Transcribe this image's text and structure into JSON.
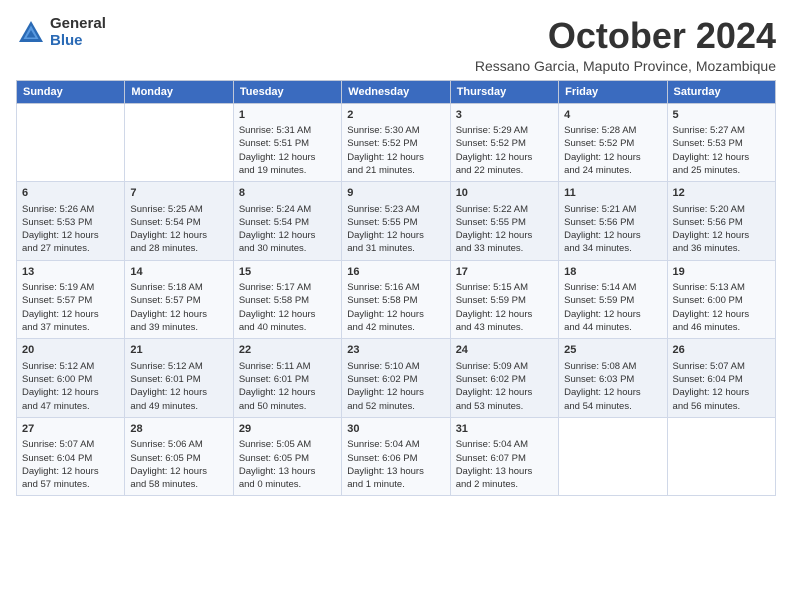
{
  "logo": {
    "general": "General",
    "blue": "Blue"
  },
  "title": "October 2024",
  "subtitle": "Ressano Garcia, Maputo Province, Mozambique",
  "days": [
    "Sunday",
    "Monday",
    "Tuesday",
    "Wednesday",
    "Thursday",
    "Friday",
    "Saturday"
  ],
  "weeks": [
    [
      {
        "day": "",
        "content": ""
      },
      {
        "day": "",
        "content": ""
      },
      {
        "day": "1",
        "content": "Sunrise: 5:31 AM\nSunset: 5:51 PM\nDaylight: 12 hours\nand 19 minutes."
      },
      {
        "day": "2",
        "content": "Sunrise: 5:30 AM\nSunset: 5:52 PM\nDaylight: 12 hours\nand 21 minutes."
      },
      {
        "day": "3",
        "content": "Sunrise: 5:29 AM\nSunset: 5:52 PM\nDaylight: 12 hours\nand 22 minutes."
      },
      {
        "day": "4",
        "content": "Sunrise: 5:28 AM\nSunset: 5:52 PM\nDaylight: 12 hours\nand 24 minutes."
      },
      {
        "day": "5",
        "content": "Sunrise: 5:27 AM\nSunset: 5:53 PM\nDaylight: 12 hours\nand 25 minutes."
      }
    ],
    [
      {
        "day": "6",
        "content": "Sunrise: 5:26 AM\nSunset: 5:53 PM\nDaylight: 12 hours\nand 27 minutes."
      },
      {
        "day": "7",
        "content": "Sunrise: 5:25 AM\nSunset: 5:54 PM\nDaylight: 12 hours\nand 28 minutes."
      },
      {
        "day": "8",
        "content": "Sunrise: 5:24 AM\nSunset: 5:54 PM\nDaylight: 12 hours\nand 30 minutes."
      },
      {
        "day": "9",
        "content": "Sunrise: 5:23 AM\nSunset: 5:55 PM\nDaylight: 12 hours\nand 31 minutes."
      },
      {
        "day": "10",
        "content": "Sunrise: 5:22 AM\nSunset: 5:55 PM\nDaylight: 12 hours\nand 33 minutes."
      },
      {
        "day": "11",
        "content": "Sunrise: 5:21 AM\nSunset: 5:56 PM\nDaylight: 12 hours\nand 34 minutes."
      },
      {
        "day": "12",
        "content": "Sunrise: 5:20 AM\nSunset: 5:56 PM\nDaylight: 12 hours\nand 36 minutes."
      }
    ],
    [
      {
        "day": "13",
        "content": "Sunrise: 5:19 AM\nSunset: 5:57 PM\nDaylight: 12 hours\nand 37 minutes."
      },
      {
        "day": "14",
        "content": "Sunrise: 5:18 AM\nSunset: 5:57 PM\nDaylight: 12 hours\nand 39 minutes."
      },
      {
        "day": "15",
        "content": "Sunrise: 5:17 AM\nSunset: 5:58 PM\nDaylight: 12 hours\nand 40 minutes."
      },
      {
        "day": "16",
        "content": "Sunrise: 5:16 AM\nSunset: 5:58 PM\nDaylight: 12 hours\nand 42 minutes."
      },
      {
        "day": "17",
        "content": "Sunrise: 5:15 AM\nSunset: 5:59 PM\nDaylight: 12 hours\nand 43 minutes."
      },
      {
        "day": "18",
        "content": "Sunrise: 5:14 AM\nSunset: 5:59 PM\nDaylight: 12 hours\nand 44 minutes."
      },
      {
        "day": "19",
        "content": "Sunrise: 5:13 AM\nSunset: 6:00 PM\nDaylight: 12 hours\nand 46 minutes."
      }
    ],
    [
      {
        "day": "20",
        "content": "Sunrise: 5:12 AM\nSunset: 6:00 PM\nDaylight: 12 hours\nand 47 minutes."
      },
      {
        "day": "21",
        "content": "Sunrise: 5:12 AM\nSunset: 6:01 PM\nDaylight: 12 hours\nand 49 minutes."
      },
      {
        "day": "22",
        "content": "Sunrise: 5:11 AM\nSunset: 6:01 PM\nDaylight: 12 hours\nand 50 minutes."
      },
      {
        "day": "23",
        "content": "Sunrise: 5:10 AM\nSunset: 6:02 PM\nDaylight: 12 hours\nand 52 minutes."
      },
      {
        "day": "24",
        "content": "Sunrise: 5:09 AM\nSunset: 6:02 PM\nDaylight: 12 hours\nand 53 minutes."
      },
      {
        "day": "25",
        "content": "Sunrise: 5:08 AM\nSunset: 6:03 PM\nDaylight: 12 hours\nand 54 minutes."
      },
      {
        "day": "26",
        "content": "Sunrise: 5:07 AM\nSunset: 6:04 PM\nDaylight: 12 hours\nand 56 minutes."
      }
    ],
    [
      {
        "day": "27",
        "content": "Sunrise: 5:07 AM\nSunset: 6:04 PM\nDaylight: 12 hours\nand 57 minutes."
      },
      {
        "day": "28",
        "content": "Sunrise: 5:06 AM\nSunset: 6:05 PM\nDaylight: 12 hours\nand 58 minutes."
      },
      {
        "day": "29",
        "content": "Sunrise: 5:05 AM\nSunset: 6:05 PM\nDaylight: 13 hours\nand 0 minutes."
      },
      {
        "day": "30",
        "content": "Sunrise: 5:04 AM\nSunset: 6:06 PM\nDaylight: 13 hours\nand 1 minute."
      },
      {
        "day": "31",
        "content": "Sunrise: 5:04 AM\nSunset: 6:07 PM\nDaylight: 13 hours\nand 2 minutes."
      },
      {
        "day": "",
        "content": ""
      },
      {
        "day": "",
        "content": ""
      }
    ]
  ]
}
